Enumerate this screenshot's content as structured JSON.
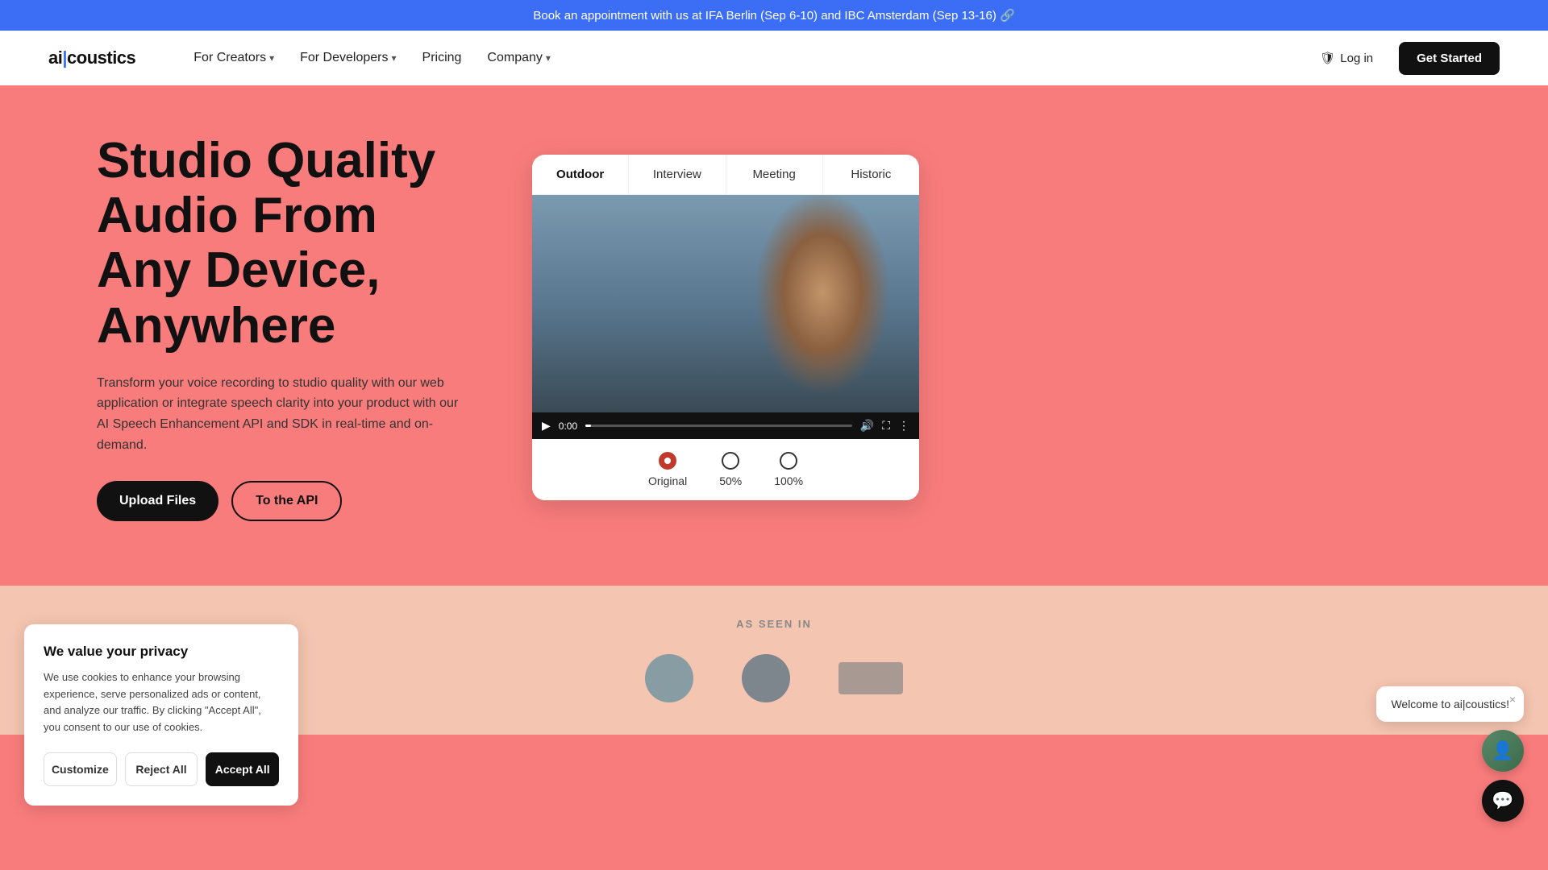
{
  "announcement": {
    "text": "Book an appointment with us at IFA Berlin (Sep 6-10) and IBC Amsterdam (Sep 13-16) 🔗"
  },
  "nav": {
    "logo": "ai|coustics",
    "links": [
      {
        "label": "For Creators",
        "hasDropdown": true
      },
      {
        "label": "For Developers",
        "hasDropdown": true
      },
      {
        "label": "Pricing",
        "hasDropdown": false
      },
      {
        "label": "Company",
        "hasDropdown": true
      }
    ],
    "login_label": "Log in",
    "cta_label": "Get Started"
  },
  "hero": {
    "title": "Studio Quality Audio From Any Device, Anywhere",
    "description": "Transform your voice recording to studio quality with our web application or integrate speech clarity into your product with our AI Speech Enhancement API and SDK in real-time and on-demand.",
    "btn_upload": "Upload Files",
    "btn_api": "To the API"
  },
  "video_card": {
    "tabs": [
      {
        "label": "Outdoor",
        "active": true
      },
      {
        "label": "Interview",
        "active": false
      },
      {
        "label": "Meeting",
        "active": false
      },
      {
        "label": "Historic",
        "active": false
      }
    ],
    "time": "0:00",
    "radio_options": [
      {
        "label": "Original",
        "selected": true
      },
      {
        "label": "50%",
        "selected": false
      },
      {
        "label": "100%",
        "selected": false
      }
    ]
  },
  "cookie": {
    "title": "We value your privacy",
    "text": "We use cookies to enhance your browsing experience, serve personalized ads or content, and analyze our traffic. By clicking \"Accept All\", you consent to our use of cookies.",
    "btn_customize": "Customize",
    "btn_reject": "Reject All",
    "btn_accept": "Accept All"
  },
  "chat": {
    "welcome_text": "Welcome to ai|coustics!",
    "close_icon": "×"
  },
  "bottom": {
    "as_seen_in": "AS SEEN IN"
  }
}
